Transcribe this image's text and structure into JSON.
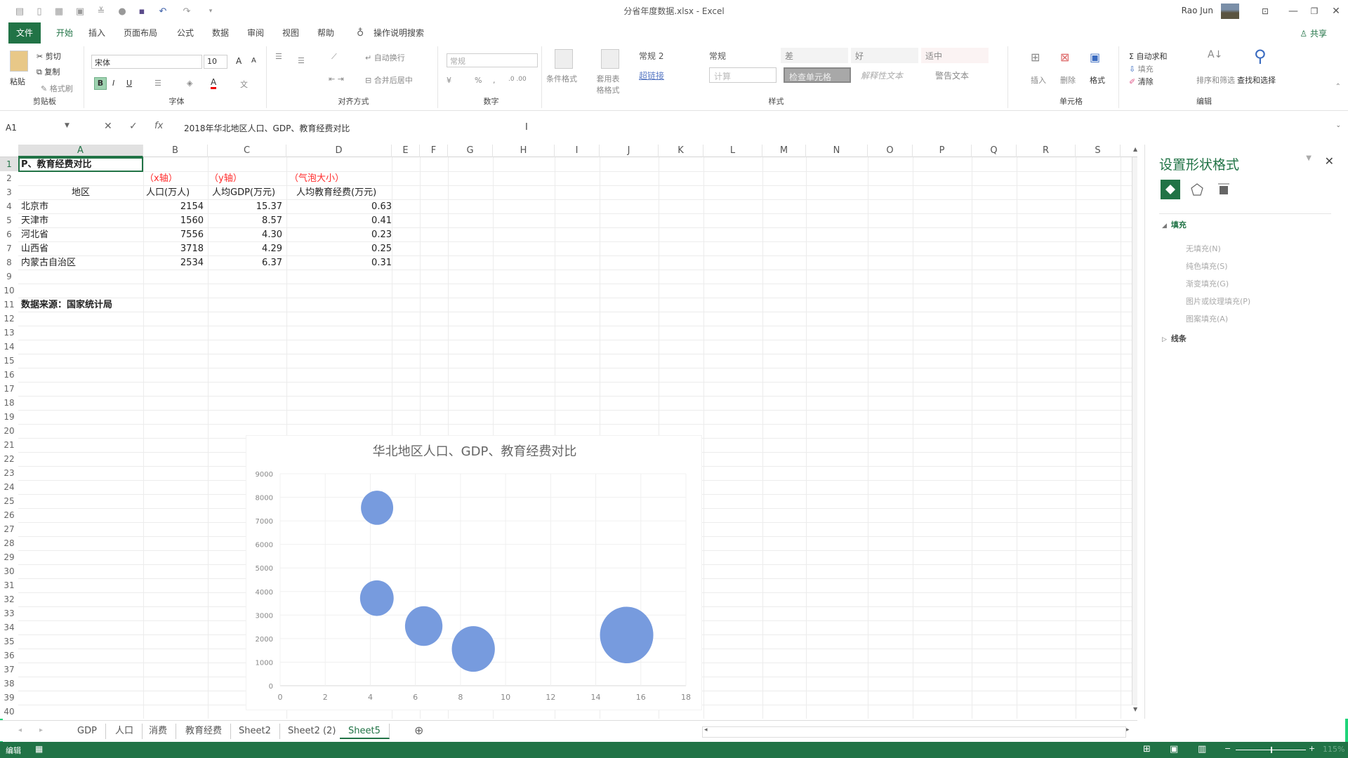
{
  "window": {
    "title": "分省年度数据.xlsx  -  Excel",
    "user": "Rao Jun",
    "qat_icons": [
      "new-icon",
      "open-icon",
      "print-preview-icon",
      "form-icon",
      "sort-icon",
      "circle-icon",
      "save-icon",
      "undo-icon",
      "redo-icon",
      "customize-icon"
    ]
  },
  "menu": {
    "tabs": [
      "文件",
      "开始",
      "插入",
      "页面布局",
      "公式",
      "数据",
      "审阅",
      "视图",
      "帮助"
    ],
    "active": "开始",
    "search": "操作说明搜索",
    "share": "共享"
  },
  "ribbon": {
    "clipboard": {
      "label": "剪贴板",
      "paste": "粘贴",
      "cut": "剪切",
      "copy": "复制",
      "format_painter": "格式刷"
    },
    "font": {
      "label": "字体",
      "font_name": "宋体",
      "font_size": "10",
      "bold": "B",
      "italic": "I",
      "underline": "U",
      "grow": "A",
      "shrink": "A"
    },
    "alignment": {
      "label": "对齐方式",
      "wrap": "自动换行",
      "merge": "合并后居中"
    },
    "number": {
      "label": "数字",
      "format": "常规",
      "percent": "%",
      "comma": ","
    },
    "styles": {
      "label": "样式",
      "conditional": "条件格式",
      "table": "套用表格格式",
      "cells": [
        {
          "name": "常规 2"
        },
        {
          "name": "常规"
        },
        {
          "name": "差"
        },
        {
          "name": "好"
        },
        {
          "name": "适中"
        },
        {
          "name": "超链接"
        },
        {
          "name": "计算"
        },
        {
          "name": "检查单元格"
        },
        {
          "name": "解释性文本"
        },
        {
          "name": "警告文本"
        }
      ]
    },
    "cells": {
      "label": "单元格",
      "insert": "插入",
      "delete": "删除",
      "format": "格式"
    },
    "editing": {
      "label": "编辑",
      "autosum": "自动求和",
      "fill": "填充",
      "clear": "清除",
      "sort": "排序和筛选",
      "find": "查找和选择"
    }
  },
  "formula_bar": {
    "name_box": "A1",
    "formula": "2018年华北地区人口、GDP、教育经费对比"
  },
  "sheet": {
    "columns": [
      "A",
      "B",
      "C",
      "D",
      "E",
      "F",
      "G",
      "H",
      "I",
      "J",
      "K",
      "L",
      "M",
      "N",
      "O",
      "P",
      "Q",
      "R",
      "S"
    ],
    "rows": 40,
    "a1_display": "P、教育经费对比",
    "axis_hints": [
      "（x轴）",
      "（y轴）",
      "（气泡大小）"
    ],
    "headers": [
      "地区",
      "人口(万人)",
      "人均GDP(万元)",
      "人均教育经费(万元)"
    ],
    "data": [
      [
        "北京市",
        "2154",
        "15.37",
        "0.63"
      ],
      [
        "天津市",
        "1560",
        "8.57",
        "0.41"
      ],
      [
        "河北省",
        "7556",
        "4.30",
        "0.23"
      ],
      [
        "山西省",
        "3718",
        "4.29",
        "0.25"
      ],
      [
        "内蒙古自治区",
        "2534",
        "6.37",
        "0.31"
      ]
    ],
    "source_note": "数据来源：国家统计局"
  },
  "chart_data": {
    "type": "bubble",
    "title": "华北地区人口、GDP、教育经费对比",
    "xlabel": "",
    "ylabel": "",
    "xlim": [
      0,
      18
    ],
    "ylim": [
      0,
      9000
    ],
    "x_ticks": [
      "0",
      "2",
      "4",
      "6",
      "8",
      "10",
      "12",
      "14",
      "16",
      "18"
    ],
    "y_ticks": [
      "0",
      "1000",
      "2000",
      "3000",
      "4000",
      "5000",
      "6000",
      "7000",
      "8000",
      "9000"
    ],
    "grid": true,
    "legend": "none",
    "color": "#7096dc",
    "series": [
      {
        "name": "人口(万人)",
        "points": [
          {
            "label": "北京市",
            "x": 15.37,
            "y": 2154,
            "size": 0.63
          },
          {
            "label": "天津市",
            "x": 8.57,
            "y": 1560,
            "size": 0.41
          },
          {
            "label": "河北省",
            "x": 4.3,
            "y": 7556,
            "size": 0.23
          },
          {
            "label": "山西省",
            "x": 4.29,
            "y": 3718,
            "size": 0.25
          },
          {
            "label": "内蒙古自治区",
            "x": 6.37,
            "y": 2534,
            "size": 0.31
          }
        ]
      }
    ]
  },
  "format_pane": {
    "title": "设置形状格式",
    "tabs": [
      "fill-line-icon",
      "effects-icon",
      "size-properties-icon"
    ],
    "fill_section": "填充",
    "fill_options": [
      "无填充(N)",
      "纯色填充(S)",
      "渐变填充(G)",
      "图片或纹理填充(P)",
      "图案填充(A)"
    ],
    "line_section": "线条"
  },
  "sheet_tabs": {
    "tabs": [
      "GDP",
      "人口",
      "消费",
      "教育经费",
      "Sheet2",
      "Sheet2 (2)",
      "Sheet5"
    ],
    "active": "Sheet5"
  },
  "status": {
    "mode": "编辑",
    "zoom": "115%"
  },
  "colors": {
    "accent": "#217346",
    "red_hint": "#ff2a2a",
    "bubble": "#7096dc"
  }
}
